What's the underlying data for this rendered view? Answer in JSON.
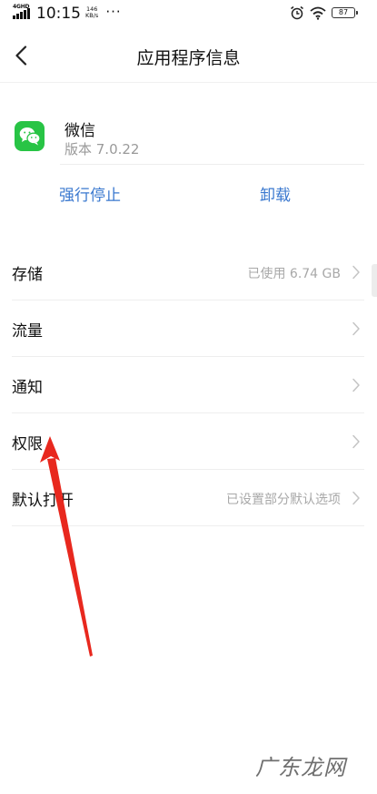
{
  "status_bar": {
    "network": "4GHD",
    "time": "10:15",
    "speed_value": "146",
    "speed_unit": "KB/s",
    "more": "···",
    "battery": "87"
  },
  "header": {
    "title": "应用程序信息",
    "back_icon": "chevron-left-icon"
  },
  "app": {
    "name": "微信",
    "version": "版本 7.0.22",
    "icon": "wechat-icon",
    "icon_color": "#28c445"
  },
  "actions": {
    "force_stop": "强行停止",
    "uninstall": "卸载",
    "accent_color": "#3a78cf"
  },
  "settings": [
    {
      "label": "存储",
      "value": "已使用 6.74 GB"
    },
    {
      "label": "流量",
      "value": ""
    },
    {
      "label": "通知",
      "value": ""
    },
    {
      "label": "权限",
      "value": ""
    },
    {
      "label": "默认打开",
      "value": "已设置部分默认选项"
    }
  ],
  "annotation": {
    "arrow_color": "#e8281e"
  },
  "watermark": "广东龙网"
}
